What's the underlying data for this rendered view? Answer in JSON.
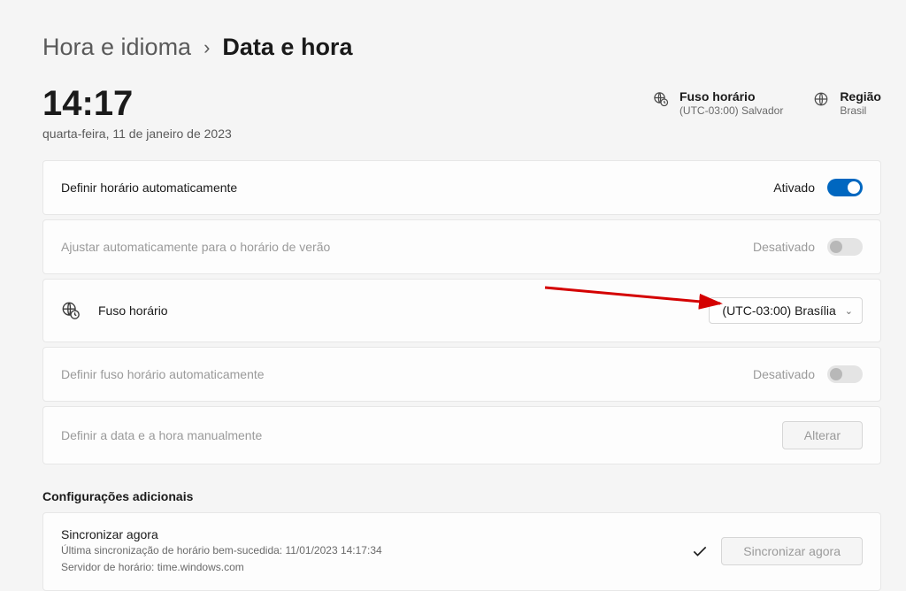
{
  "breadcrumb": {
    "parent": "Hora e idioma",
    "current": "Data e hora"
  },
  "clock": {
    "time": "14:17",
    "date": "quarta-feira, 11 de janeiro de 2023"
  },
  "info": {
    "timezone_title": "Fuso horário",
    "timezone_value": "(UTC-03:00) Salvador",
    "region_title": "Região",
    "region_value": "Brasil"
  },
  "rows": {
    "auto_time": {
      "label": "Definir horário automaticamente",
      "status": "Ativado"
    },
    "dst": {
      "label": "Ajustar automaticamente para o horário de verão",
      "status": "Desativado"
    },
    "timezone": {
      "label": "Fuso horário",
      "value": "(UTC-03:00) Brasília"
    },
    "auto_timezone": {
      "label": "Definir fuso horário automaticamente",
      "status": "Desativado"
    },
    "manual": {
      "label": "Definir a data e a hora manualmente",
      "button": "Alterar"
    }
  },
  "additional": {
    "header": "Configurações adicionais",
    "sync": {
      "title": "Sincronizar agora",
      "last_sync": "Última sincronização de horário bem-sucedida: 11/01/2023 14:17:34",
      "server": "Servidor de horário: time.windows.com",
      "button": "Sincronizar agora"
    }
  }
}
